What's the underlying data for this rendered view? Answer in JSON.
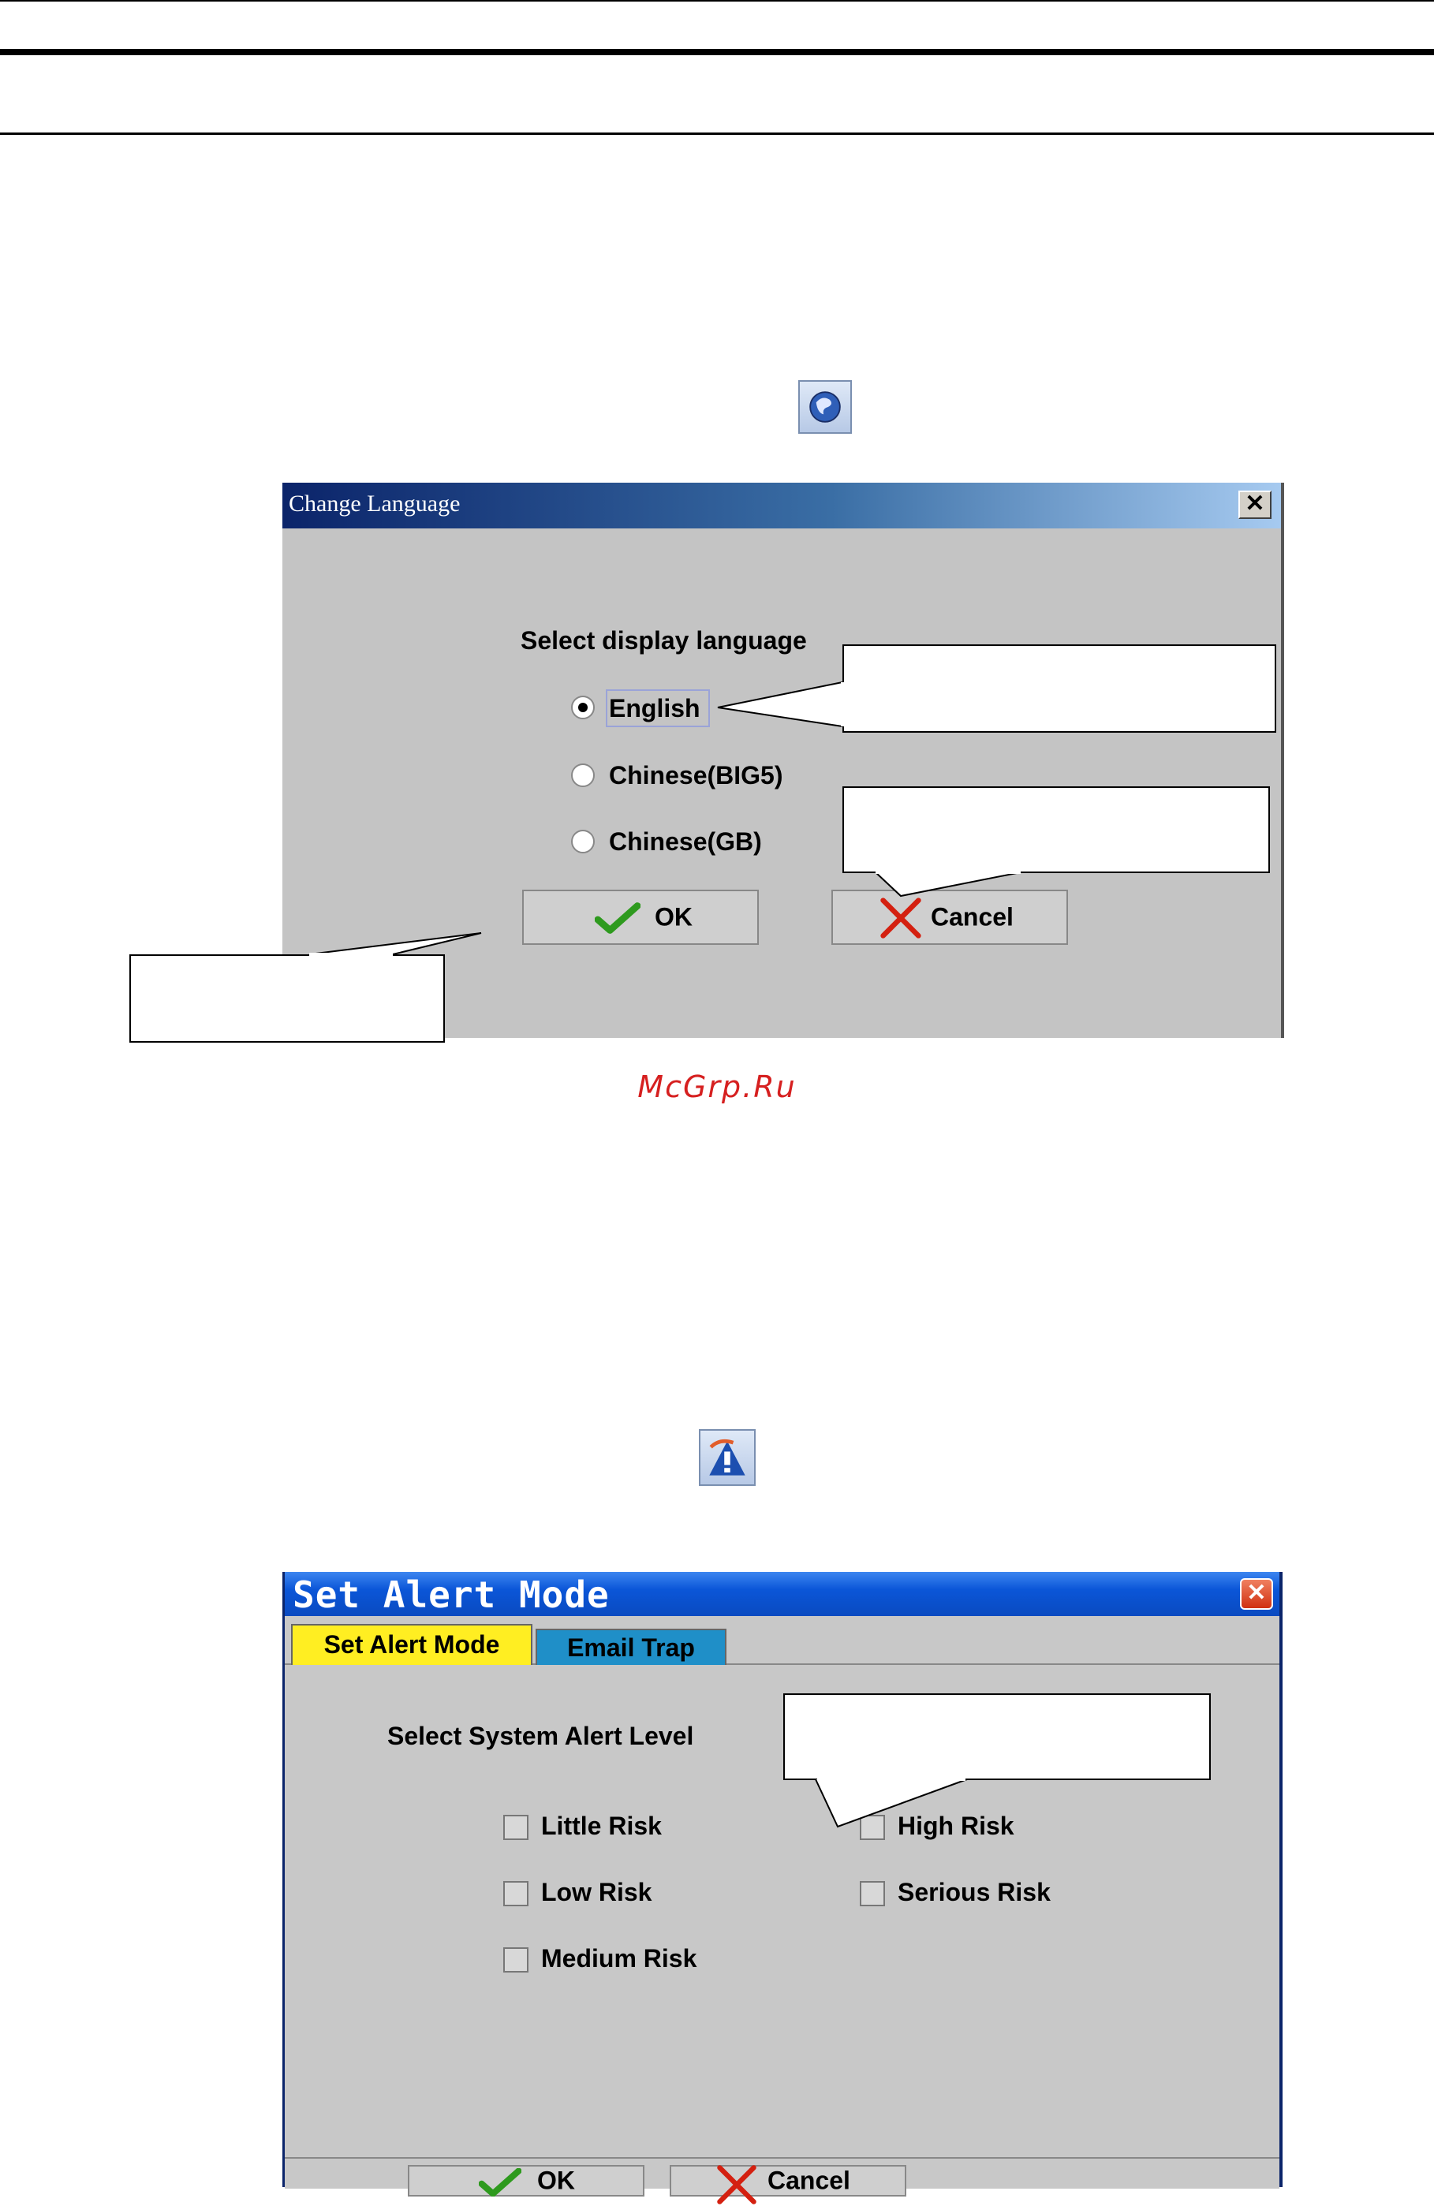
{
  "watermark": "McGrp.Ru",
  "icons": {
    "language_icon": "globe-icon",
    "alert_icon": "road-warning-icon"
  },
  "change_language": {
    "title": "Change Language",
    "close_glyph": "✕",
    "prompt": "Select display language",
    "options": [
      "English",
      "Chinese(BIG5)",
      "Chinese(GB)"
    ],
    "selected": "English",
    "ok_label": "OK",
    "cancel_label": "Cancel"
  },
  "set_alert_mode": {
    "title": "Set Alert Mode",
    "close_glyph": "✕",
    "tabs": [
      "Set Alert Mode",
      "Email Trap"
    ],
    "active_tab": "Set Alert Mode",
    "prompt": "Select System Alert Level",
    "levels": [
      "Little Risk",
      "Low Risk",
      "Medium Risk",
      "High Risk",
      "Serious Risk"
    ],
    "ok_label": "OK",
    "cancel_label": "Cancel"
  },
  "colors": {
    "ok_check": "#2e9a1e",
    "cancel_x": "#d42010",
    "active_tab": "#ffee22",
    "inactive_tab": "#1f8fc8",
    "watermark": "#d62020"
  }
}
